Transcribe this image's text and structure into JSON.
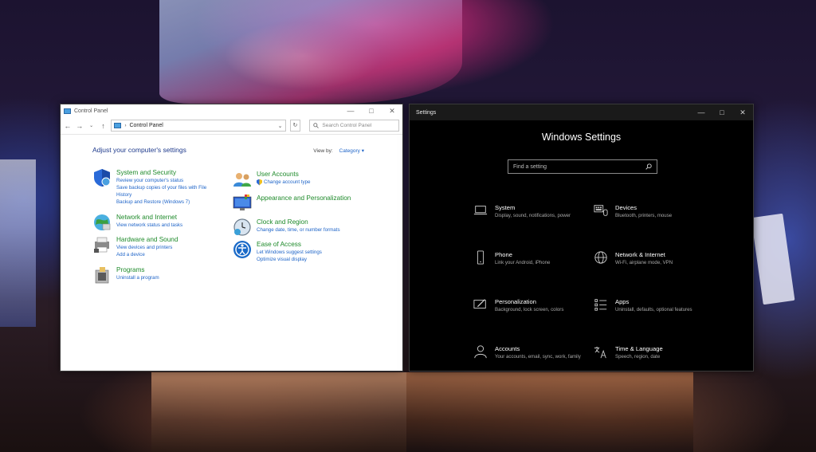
{
  "control_panel": {
    "window_title": "Control Panel",
    "address_path": "Control Panel",
    "search_placeholder": "Search Control Panel",
    "heading": "Adjust your computer's settings",
    "view_by_label": "View by:",
    "view_by_value": "Category",
    "categories": [
      {
        "name": "System and Security",
        "links": [
          "Review your computer's status",
          "Save backup copies of your files with File History",
          "Backup and Restore (Windows 7)"
        ]
      },
      {
        "name": "Network and Internet",
        "links": [
          "View network status and tasks"
        ]
      },
      {
        "name": "Hardware and Sound",
        "links": [
          "View devices and printers",
          "Add a device"
        ]
      },
      {
        "name": "Programs",
        "links": [
          "Uninstall a program"
        ]
      },
      {
        "name": "User Accounts",
        "links": [
          "Change account type"
        ]
      },
      {
        "name": "Appearance and Personalization",
        "links": []
      },
      {
        "name": "Clock and Region",
        "links": [
          "Change date, time, or number formats"
        ]
      },
      {
        "name": "Ease of Access",
        "links": [
          "Let Windows suggest settings",
          "Optimize visual display"
        ]
      }
    ]
  },
  "settings": {
    "window_title": "Settings",
    "heading": "Windows Settings",
    "search_placeholder": "Find a setting",
    "items": [
      {
        "name": "System",
        "desc": "Display, sound, notifications, power",
        "icon": "laptop-icon"
      },
      {
        "name": "Devices",
        "desc": "Bluetooth, printers, mouse",
        "icon": "keyboard-icon"
      },
      {
        "name": "Phone",
        "desc": "Link your Android, iPhone",
        "icon": "phone-icon"
      },
      {
        "name": "Network & Internet",
        "desc": "Wi-Fi, airplane mode, VPN",
        "icon": "globe-icon"
      },
      {
        "name": "Personalization",
        "desc": "Background, lock screen, colors",
        "icon": "paint-icon"
      },
      {
        "name": "Apps",
        "desc": "Uninstall, defaults, optional features",
        "icon": "apps-list-icon"
      },
      {
        "name": "Accounts",
        "desc": "Your accounts, email, sync, work, family",
        "icon": "person-icon"
      },
      {
        "name": "Time & Language",
        "desc": "Speech, region, date",
        "icon": "time-language-icon"
      }
    ]
  }
}
